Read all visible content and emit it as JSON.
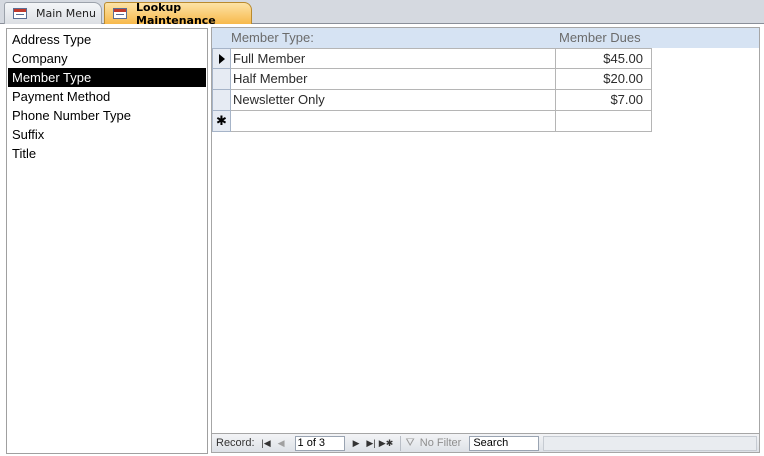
{
  "tabs": [
    {
      "label": "Main Menu",
      "active": false
    },
    {
      "label": "Lookup Maintenance",
      "active": true
    }
  ],
  "lookup_list": {
    "items": [
      "Address Type",
      "Company",
      "Member Type",
      "Payment Method",
      "Phone Number Type",
      "Suffix",
      "Title"
    ],
    "selected": "Member Type"
  },
  "subform": {
    "headers": {
      "member_type": "Member Type:",
      "member_dues": "Member Dues"
    },
    "rows": [
      {
        "member_type": "Full Member",
        "member_dues": "$45.00"
      },
      {
        "member_type": "Half Member",
        "member_dues": "$20.00"
      },
      {
        "member_type": "Newsletter Only",
        "member_dues": "$7.00"
      }
    ]
  },
  "navigation": {
    "record_label": "Record:",
    "current": "1 of 3",
    "filter_label": "No Filter",
    "search_label": "Search"
  },
  "colors": {
    "active_tab": "#f7b94c",
    "selected_item_bg": "#000000",
    "header_bg": "#d6e3f3"
  }
}
